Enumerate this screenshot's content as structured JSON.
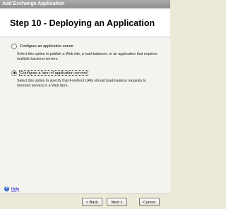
{
  "window": {
    "title": "Add Exchange Application"
  },
  "header": {
    "title": "Step 10 - Deploying an Application"
  },
  "options": [
    {
      "label": "Configure an application server",
      "description": "Select this option to publish a Web site, a load-balancer, or an application that requires multiple backend servers.",
      "selected": false
    },
    {
      "label": "Configure a farm of application servers",
      "description": "Select this option to specify that Forefront UAG should load-balance requests to mirrored servers in a Web farm.",
      "selected": true
    }
  ],
  "help": {
    "icon": "help-icon",
    "label": "Help"
  },
  "buttons": {
    "back": "< Back",
    "next": "Next >",
    "cancel": "Cancel"
  }
}
